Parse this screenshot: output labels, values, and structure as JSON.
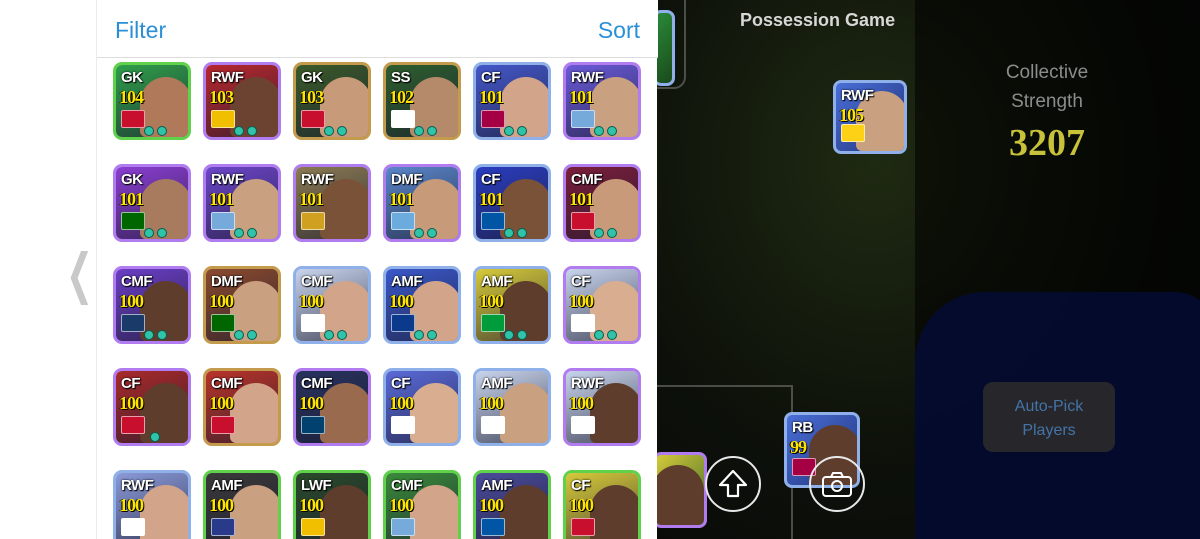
{
  "panel": {
    "filter_label": "Filter",
    "sort_label": "Sort"
  },
  "players": [
    {
      "pos": "GK",
      "rating": "104",
      "theme": "g",
      "bg": "#2f9e4a",
      "face": "#b07a5a",
      "emblem": "#c8102e",
      "dots": 2
    },
    {
      "pos": "RWF",
      "rating": "103",
      "theme": "p",
      "bg": "#b7282e",
      "face": "#6b4330",
      "emblem": "#f1bf00",
      "dots": 2
    },
    {
      "pos": "GK",
      "rating": "103",
      "theme": "d",
      "bg": "#3a5a2a",
      "face": "#c79a7a",
      "emblem": "#c8102e",
      "dots": 2
    },
    {
      "pos": "SS",
      "rating": "102",
      "theme": "d",
      "bg": "#2d5e2e",
      "face": "#b58a6a",
      "emblem": "#ffffff",
      "dots": 2
    },
    {
      "pos": "CF",
      "rating": "101",
      "theme": "s",
      "bg": "#4457c9",
      "face": "#d2a58a",
      "emblem": "#a50044",
      "dots": 2
    },
    {
      "pos": "RWF",
      "rating": "101",
      "theme": "p",
      "bg": "#6a5ad8",
      "face": "#c9a080",
      "emblem": "#75aadb",
      "dots": 2
    },
    {
      "pos": "GK",
      "rating": "101",
      "theme": "p",
      "bg": "#8a3ed1",
      "face": "#a87a5e",
      "emblem": "#006600",
      "dots": 2
    },
    {
      "pos": "RWF",
      "rating": "101",
      "theme": "p",
      "bg": "#6c46c9",
      "face": "#c9a080",
      "emblem": "#75aadb",
      "dots": 2
    },
    {
      "pos": "RWF",
      "rating": "101",
      "theme": "p",
      "bg": "#8a7a52",
      "face": "#7a5238",
      "emblem": "#d0a020",
      "dots": 0
    },
    {
      "pos": "DMF",
      "rating": "101",
      "theme": "p",
      "bg": "#5a86c9",
      "face": "#c79a7a",
      "emblem": "#6cabdd",
      "dots": 2
    },
    {
      "pos": "CF",
      "rating": "101",
      "theme": "s",
      "bg": "#2a3dbf",
      "face": "#7a5238",
      "emblem": "#0055a4",
      "dots": 2
    },
    {
      "pos": "CMF",
      "rating": "101",
      "theme": "p",
      "bg": "#7a1e3a",
      "face": "#c99a7a",
      "emblem": "#c8102e",
      "dots": 2
    },
    {
      "pos": "CMF",
      "rating": "100",
      "theme": "p",
      "bg": "#6a3ec4",
      "face": "#5e3d2c",
      "emblem": "#1a3a6a",
      "dots": 2
    },
    {
      "pos": "DMF",
      "rating": "100",
      "theme": "d",
      "bg": "#8a4a2e",
      "face": "#c9a080",
      "emblem": "#006600",
      "dots": 2
    },
    {
      "pos": "CMF",
      "rating": "100",
      "theme": "s",
      "bg": "#c8d4ec",
      "face": "#d2a58a",
      "emblem": "#ffffff",
      "dots": 2
    },
    {
      "pos": "AMF",
      "rating": "100",
      "theme": "s",
      "bg": "#3a58c9",
      "face": "#d2a58a",
      "emblem": "#0b3a8c",
      "dots": 2
    },
    {
      "pos": "AMF",
      "rating": "100",
      "theme": "s",
      "bg": "#d6c93a",
      "face": "#5e3d2c",
      "emblem": "#009c3b",
      "dots": 2
    },
    {
      "pos": "CF",
      "rating": "100",
      "theme": "p",
      "bg": "#c8d4ec",
      "face": "#d8ad90",
      "emblem": "#ffffff",
      "dots": 2
    },
    {
      "pos": "CF",
      "rating": "100",
      "theme": "p",
      "bg": "#a82a2a",
      "face": "#5e3d2c",
      "emblem": "#c8102e",
      "dots": 1
    },
    {
      "pos": "CMF",
      "rating": "100",
      "theme": "d",
      "bg": "#b8342a",
      "face": "#d2a58a",
      "emblem": "#c8102e",
      "dots": 0
    },
    {
      "pos": "CMF",
      "rating": "100",
      "theme": "p",
      "bg": "#28325e",
      "face": "#9a6a4e",
      "emblem": "#004170",
      "dots": 0
    },
    {
      "pos": "CF",
      "rating": "100",
      "theme": "s",
      "bg": "#5a6ad8",
      "face": "#d8ad90",
      "emblem": "#ffffff",
      "dots": 0
    },
    {
      "pos": "AMF",
      "rating": "100",
      "theme": "s",
      "bg": "#c8d4ec",
      "face": "#c9a080",
      "emblem": "#ffffff",
      "dots": 0
    },
    {
      "pos": "RWF",
      "rating": "100",
      "theme": "p",
      "bg": "#c8d4ec",
      "face": "#5e3d2c",
      "emblem": "#ffffff",
      "dots": 0
    },
    {
      "pos": "RWF",
      "rating": "100",
      "theme": "s",
      "bg": "#8a9ad8",
      "face": "#d2a58a",
      "emblem": "#ffffff",
      "dots": 0
    },
    {
      "pos": "AMF",
      "rating": "100",
      "theme": "g",
      "bg": "#3a3a3a",
      "face": "#c9a080",
      "emblem": "#2a3a8a",
      "dots": 0
    },
    {
      "pos": "LWF",
      "rating": "100",
      "theme": "g",
      "bg": "#2a4a2a",
      "face": "#5e3d2c",
      "emblem": "#f1bf00",
      "dots": 0
    },
    {
      "pos": "CMF",
      "rating": "100",
      "theme": "g",
      "bg": "#3a8a3a",
      "face": "#d2a58a",
      "emblem": "#75aadb",
      "dots": 0
    },
    {
      "pos": "AMF",
      "rating": "100",
      "theme": "g",
      "bg": "#4a4a9a",
      "face": "#5e3d2c",
      "emblem": "#0055a4",
      "dots": 0
    },
    {
      "pos": "CF",
      "rating": "100",
      "theme": "g",
      "bg": "#d6c93a",
      "face": "#5e3d2c",
      "emblem": "#c8102e",
      "dots": 0
    }
  ],
  "game": {
    "mode_title": "Possession Game",
    "strength_label_1": "Collective",
    "strength_label_2": "Strength",
    "strength_value": "3207",
    "autopick_line1": "Auto-Pick",
    "autopick_line2": "Players",
    "pitch_players": [
      {
        "pos": "RWF",
        "rating": "105"
      },
      {
        "pos": "RB",
        "rating": "99"
      }
    ]
  }
}
